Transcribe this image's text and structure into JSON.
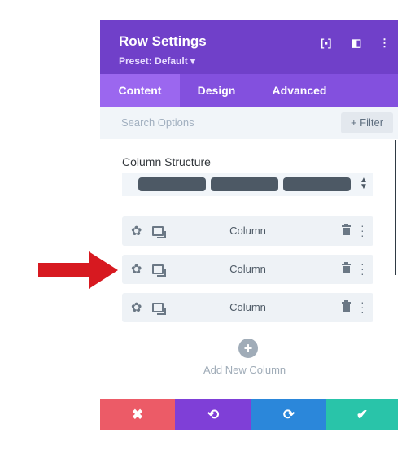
{
  "header": {
    "title": "Row Settings",
    "preset": "Preset: Default ▾"
  },
  "header_icons": {
    "focus": "focus-icon",
    "split": "split-view-icon",
    "more": "more-icon"
  },
  "tabs": [
    {
      "label": "Content"
    },
    {
      "label": "Design"
    },
    {
      "label": "Advanced"
    }
  ],
  "search": {
    "placeholder": "Search Options",
    "filter_label": "+ Filter"
  },
  "structure": {
    "label": "Column Structure"
  },
  "columns": [
    {
      "label": "Column"
    },
    {
      "label": "Column"
    },
    {
      "label": "Column"
    }
  ],
  "add": {
    "icon": "+",
    "label": "Add New Column"
  },
  "footer": {
    "discard": "✖",
    "undo": "⟲",
    "redo": "⟳",
    "save": "✔"
  },
  "colors": {
    "header": "#7040c9",
    "tabs": "#8350de",
    "discard": "#ec5b67",
    "undo": "#7f3fd7",
    "redo": "#2b87da",
    "save": "#29c4a9",
    "arrow": "#d71920"
  }
}
